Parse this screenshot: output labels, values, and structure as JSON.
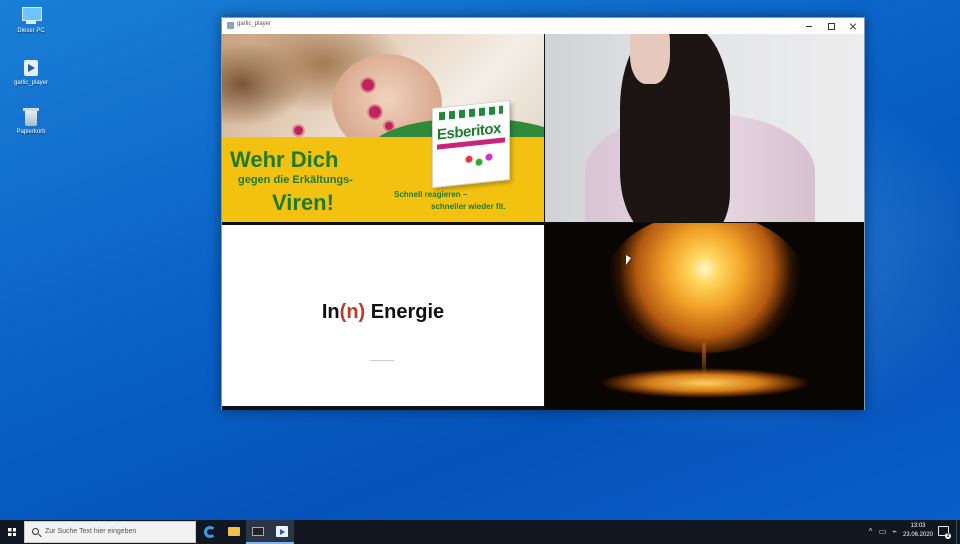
{
  "desktop": {
    "icons": [
      {
        "label": "Dieser PC",
        "icon": "this-pc-icon"
      },
      {
        "label": "garlic_player",
        "icon": "player-app-icon"
      },
      {
        "label": "Papierkorb",
        "icon": "recycle-bin-icon"
      }
    ]
  },
  "window": {
    "title": "garlic_player",
    "controls": {
      "minimize": "minimize",
      "maximize": "maximize",
      "close": "close"
    }
  },
  "tiles": {
    "ad": {
      "headline1": "Wehr Dich",
      "headline2": "gegen die Erkältungs-",
      "headline3": "Viren!",
      "tagline1": "Schnell reagieren –",
      "tagline2": "schneller wieder fit.",
      "product": "Esberitox"
    },
    "energie": {
      "prefix": "In",
      "open": "(",
      "letter": "n",
      "close": ")",
      "suffix": " Energie"
    }
  },
  "taskbar": {
    "search_placeholder": "Zur Suche Text hier eingeben",
    "apps": [
      "edge-icon",
      "file-explorer-icon",
      "terminal-icon",
      "garlic-player-icon"
    ],
    "clock_time": "13:03",
    "clock_date": "23.06.2020",
    "notification_count": "2"
  },
  "colors": {
    "taskbar_bg": "#101721",
    "ad_yellow": "#f3c210",
    "ad_green": "#1f7a2e",
    "energie_paren": "#c0392b"
  }
}
